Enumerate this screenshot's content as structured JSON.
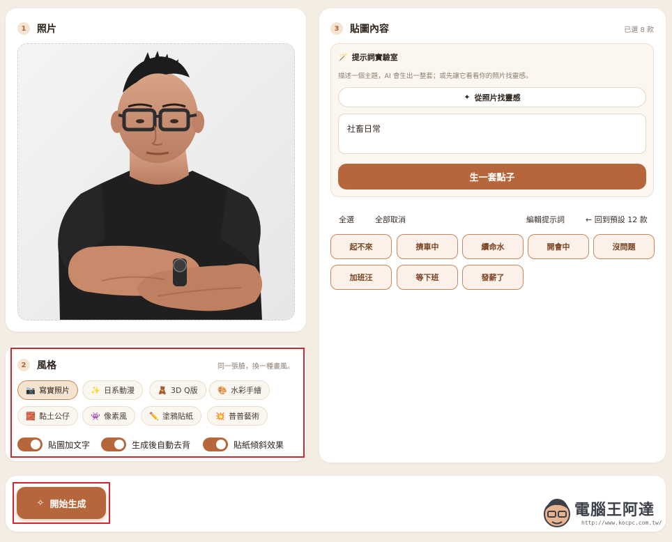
{
  "photo_section": {
    "number": "1",
    "title": "照片",
    "photo_alt": "man in black t-shirt with arms crossed"
  },
  "style_section": {
    "number": "2",
    "title": "風格",
    "subtitle": "同一張臉，換一種畫風。",
    "styles": [
      {
        "label": "寫實照片",
        "icon": "📷",
        "icon_name": "camera-icon",
        "selected": true
      },
      {
        "label": "日系動漫",
        "icon": "✨",
        "icon_name": "sparkle-icon",
        "selected": false
      },
      {
        "label": "3D Q版",
        "icon": "🧸",
        "icon_name": "teddy-icon",
        "selected": false
      },
      {
        "label": "水彩手繪",
        "icon": "🎨",
        "icon_name": "palette-icon",
        "selected": false
      },
      {
        "label": "黏土公仔",
        "icon": "🧱",
        "icon_name": "clay-icon",
        "selected": false
      },
      {
        "label": "像素風",
        "icon": "👾",
        "icon_name": "pixel-invader-icon",
        "selected": false
      },
      {
        "label": "塗鴉貼紙",
        "icon": "✏️",
        "icon_name": "pencil-icon",
        "selected": false
      },
      {
        "label": "普普藝術",
        "icon": "💥",
        "icon_name": "pop-burst-icon",
        "selected": false
      }
    ],
    "toggles": [
      {
        "label": "貼圖加文字",
        "on": true
      },
      {
        "label": "生成後自動去背",
        "on": true
      },
      {
        "label": "貼紙傾斜效果",
        "on": true
      }
    ]
  },
  "content_section": {
    "number": "3",
    "title": "貼圖內容",
    "selected_count": "已選 8 款",
    "lab": {
      "title": "提示詞實驗室",
      "description": "描述一個主題，AI 會生出一整套；或先讓它看看你的照片找靈感。",
      "inspire_button": "從照片找靈感",
      "topic_value": "社畜日常",
      "generate_button": "生一套點子"
    },
    "links": {
      "select_all": "全選",
      "deselect_all": "全部取消",
      "edit_prompts": "編輯提示詞",
      "back_default": "← 回到預設 12 款"
    },
    "stickers": [
      "起不來",
      "擠車中",
      "續命水",
      "開會中",
      "沒問題",
      "加班汪",
      "等下班",
      "發薪了"
    ]
  },
  "actions": {
    "start_button": "開始生成"
  },
  "watermark": {
    "text": "電腦王阿達",
    "url": "http://www.kocpc.com.tw/"
  },
  "colors": {
    "accent": "#b5673b",
    "highlight": "#d2262c",
    "background": "#f3ede4"
  }
}
